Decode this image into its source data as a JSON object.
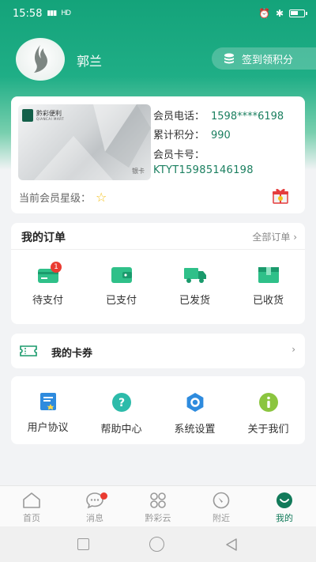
{
  "status_bar": {
    "time": "15:58",
    "signal": "HD"
  },
  "profile": {
    "name": "郭兰",
    "checkin_label": "签到领积分"
  },
  "member": {
    "card_brand": "黔彩便利",
    "card_brand_sub": "QIANCAI MART",
    "card_level": "银卡",
    "phone_label": "会员电话：",
    "phone": "1598****6198",
    "points_label": "累计积分：",
    "points": "990",
    "card_no_label": "会员卡号：",
    "card_no": "KTYT15985146198",
    "star_label": "当前会员星级："
  },
  "orders": {
    "title": "我的订单",
    "all_label": "全部订单 ›",
    "items": [
      {
        "label": "待支付",
        "icon": "wallet-card-icon",
        "badge": "1"
      },
      {
        "label": "已支付",
        "icon": "wallet-icon"
      },
      {
        "label": "已发货",
        "icon": "truck-icon"
      },
      {
        "label": "已收货",
        "icon": "package-icon"
      }
    ]
  },
  "coupon": {
    "label": "我的卡券",
    "chevron": "›"
  },
  "services": {
    "items": [
      {
        "label": "用户协议",
        "icon": "agreement-icon"
      },
      {
        "label": "帮助中心",
        "icon": "help-icon"
      },
      {
        "label": "系统设置",
        "icon": "settings-icon"
      },
      {
        "label": "关于我们",
        "icon": "info-icon"
      }
    ]
  },
  "tabs": [
    {
      "label": "首页",
      "icon": "home-icon"
    },
    {
      "label": "消息",
      "icon": "message-icon"
    },
    {
      "label": "黔彩云",
      "icon": "cloud-grid-icon"
    },
    {
      "label": "附近",
      "icon": "compass-icon"
    },
    {
      "label": "我的",
      "icon": "profile-icon",
      "active": true
    }
  ],
  "colors": {
    "brand": "#1fae86",
    "accent_text": "#1a7f5f",
    "badge": "#ea3b31",
    "star": "#f4c21b"
  }
}
